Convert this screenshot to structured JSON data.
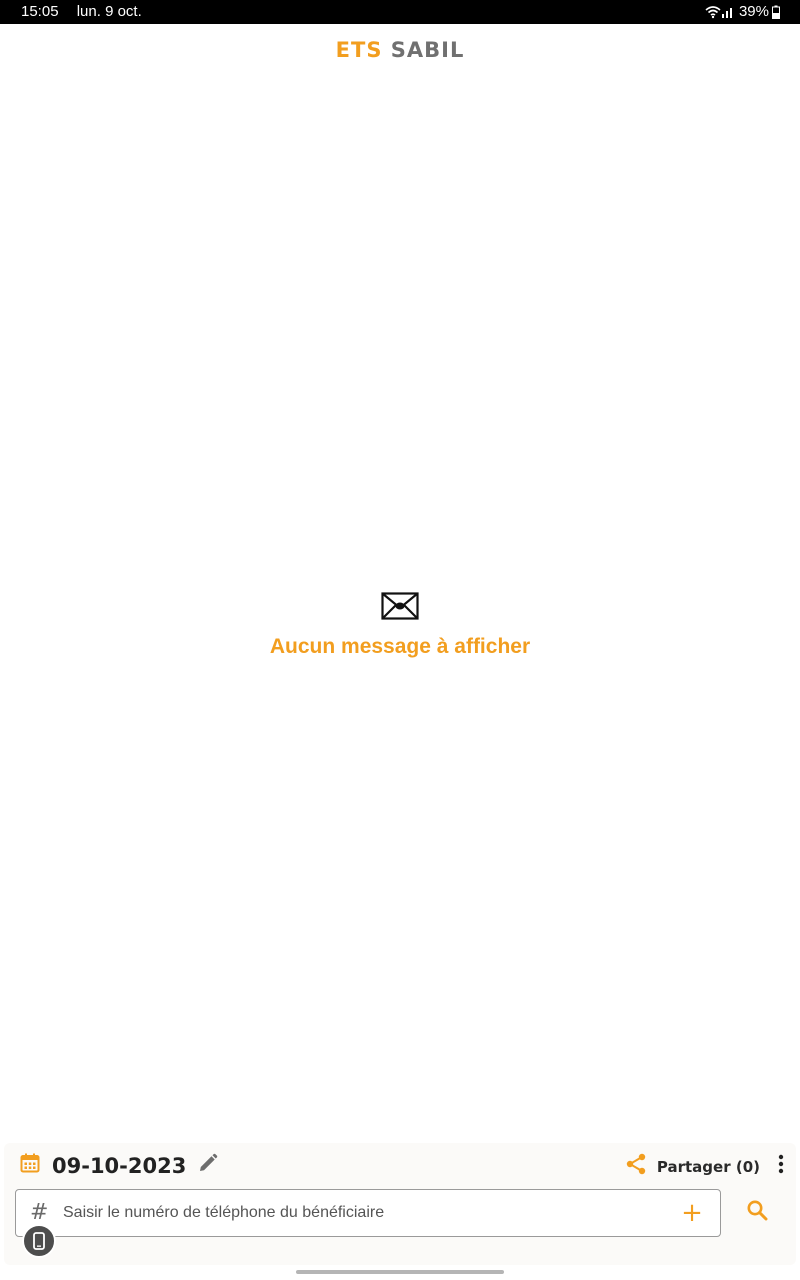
{
  "status_bar": {
    "time": "15:05",
    "date": "lun. 9 oct.",
    "battery": "39%"
  },
  "header": {
    "title_part1": "ETS",
    "title_part2": "SABIL"
  },
  "empty_state": {
    "icon": "mail-icon",
    "message": "Aucun message à afficher"
  },
  "bottom_panel": {
    "date": "09-10-2023",
    "share_label": "Partager (0)",
    "phone_input": {
      "value": "",
      "placeholder": "Saisir le numéro de téléphone du bénéficiaire"
    }
  },
  "colors": {
    "accent": "#F29E1F",
    "title_gray": "#707070",
    "status_bar_bg": "#000000"
  }
}
